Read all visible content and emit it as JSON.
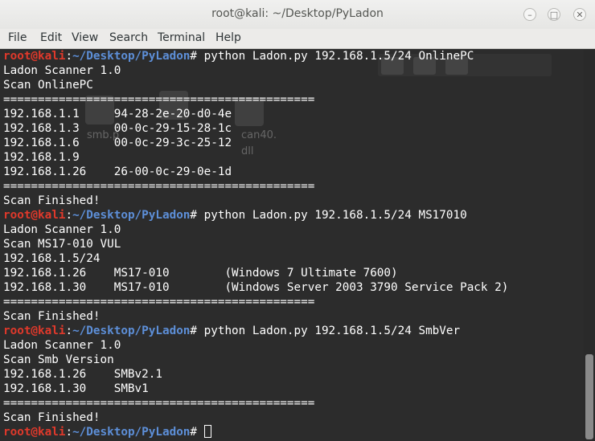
{
  "window": {
    "title": "root@kali: ~/Desktop/PyLadon",
    "minimize_glyph": "–",
    "maximize_glyph": "□",
    "close_glyph": "✕"
  },
  "menu": [
    "File",
    "Edit",
    "View",
    "Search",
    "Terminal",
    "Help"
  ],
  "prompt": {
    "user": "root@kali",
    "sep": ":",
    "path": "~/Desktop/PyLadon",
    "symbol": "# "
  },
  "lines": [
    {
      "type": "cmd",
      "text": "python Ladon.py 192.168.1.5/24 OnlinePC"
    },
    {
      "type": "out",
      "text": "Ladon Scanner 1.0"
    },
    {
      "type": "out",
      "text": "Scan OnlinePC"
    },
    {
      "type": "out",
      "text": "============================================="
    },
    {
      "type": "out",
      "text": "192.168.1.1     94-28-2e-20-d0-4e"
    },
    {
      "type": "out",
      "text": "192.168.1.3     00-0c-29-15-28-1c"
    },
    {
      "type": "out",
      "text": "192.168.1.6     00-0c-29-3c-25-12"
    },
    {
      "type": "out",
      "text": "192.168.1.9"
    },
    {
      "type": "out",
      "text": "192.168.1.26    26-00-0c-29-0e-1d"
    },
    {
      "type": "out",
      "text": "============================================="
    },
    {
      "type": "out",
      "text": "Scan Finished!"
    },
    {
      "type": "cmd",
      "text": "python Ladon.py 192.168.1.5/24 MS17010"
    },
    {
      "type": "out",
      "text": "Ladon Scanner 1.0"
    },
    {
      "type": "out",
      "text": "Scan MS17-010 VUL"
    },
    {
      "type": "out",
      "text": "192.168.1.5/24"
    },
    {
      "type": "out",
      "text": "192.168.1.26    MS17-010        (Windows 7 Ultimate 7600)"
    },
    {
      "type": "out",
      "text": "192.168.1.30    MS17-010        (Windows Server 2003 3790 Service Pack 2)"
    },
    {
      "type": "out",
      "text": "============================================="
    },
    {
      "type": "out",
      "text": "Scan Finished!"
    },
    {
      "type": "cmd",
      "text": "python Ladon.py 192.168.1.5/24 SmbVer"
    },
    {
      "type": "out",
      "text": "Ladon Scanner 1.0"
    },
    {
      "type": "out",
      "text": "Scan Smb Version"
    },
    {
      "type": "out",
      "text": "192.168.1.26    SMBv2.1"
    },
    {
      "type": "out",
      "text": "192.168.1.30    SMBv1"
    },
    {
      "type": "out",
      "text": "============================================="
    },
    {
      "type": "out",
      "text": "Scan Finished!"
    },
    {
      "type": "cmd",
      "text": ""
    }
  ],
  "background_ghost": {
    "desktop_label_1": "smb.p",
    "desktop_label_2": "can40.",
    "desktop_label_3": "dll"
  },
  "colors": {
    "user": "#e0392b",
    "path": "#5d8fd8",
    "text": "#ffffff",
    "terminal_bg": "#2c2c2c"
  }
}
